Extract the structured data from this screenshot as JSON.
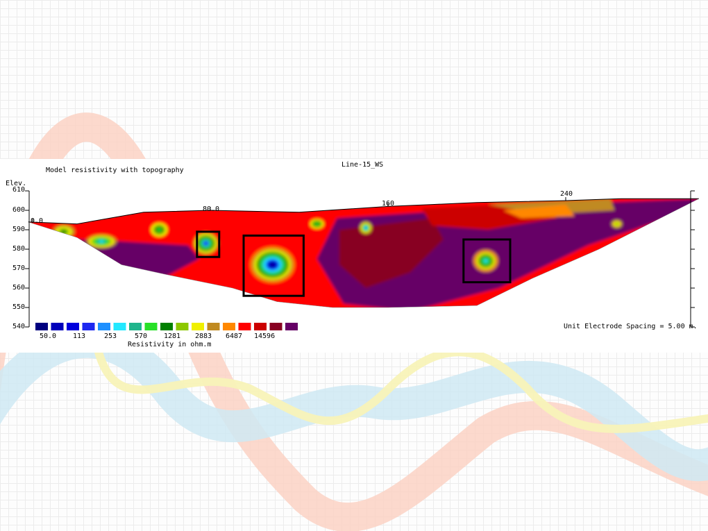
{
  "chart_data": {
    "type": "heatmap",
    "title": "Line-15_WS",
    "subtitle": "Model resistivity with topography",
    "ylabel": "Elev.",
    "x_ticks": [
      "0.0",
      "80.0",
      "160",
      "240"
    ],
    "x_tick_values": [
      0,
      80,
      160,
      240
    ],
    "xlim": [
      0,
      305
    ],
    "y_ticks": [
      610,
      600,
      590,
      580,
      570,
      560,
      550,
      540
    ],
    "ylim": [
      540,
      610
    ],
    "colorbar": {
      "title": "Resistivity in ohm.m",
      "labels": [
        "50.0",
        "113",
        "253",
        "570",
        "1281",
        "2883",
        "6487",
        "14596"
      ],
      "colors": [
        "#00007f",
        "#0000bb",
        "#0000dd",
        "#1d28f0",
        "#1e90ff",
        "#22e8ff",
        "#1fb58c",
        "#28e028",
        "#008000",
        "#8cc800",
        "#f0f000",
        "#c08a20",
        "#ff8800",
        "#ff0000",
        "#cc0000",
        "#880022",
        "#660066"
      ]
    },
    "annotation": "Unit Electrode Spacing = 5.00 m.",
    "topography": [
      [
        -2,
        594
      ],
      [
        20,
        593
      ],
      [
        50,
        599
      ],
      [
        80,
        600
      ],
      [
        120,
        599
      ],
      [
        160,
        602
      ],
      [
        180,
        603
      ],
      [
        200,
        604
      ],
      [
        240,
        605
      ],
      [
        265,
        606
      ],
      [
        300,
        606
      ]
    ],
    "base": [
      [
        -2,
        594
      ],
      [
        20,
        586
      ],
      [
        40,
        572
      ],
      [
        60,
        567
      ],
      [
        90,
        560
      ],
      [
        110,
        553
      ],
      [
        135,
        550
      ],
      [
        160,
        550
      ],
      [
        200,
        551
      ],
      [
        225,
        565
      ],
      [
        255,
        580
      ],
      [
        300,
        606
      ]
    ],
    "anomalies": [
      {
        "shape": "rect",
        "x": [
          74,
          84
        ],
        "elev": [
          576,
          589
        ]
      },
      {
        "shape": "rect",
        "x": [
          95,
          122
        ],
        "elev": [
          556,
          587
        ]
      },
      {
        "shape": "rect",
        "x": [
          194,
          215
        ],
        "elev": [
          563,
          585
        ]
      }
    ]
  }
}
